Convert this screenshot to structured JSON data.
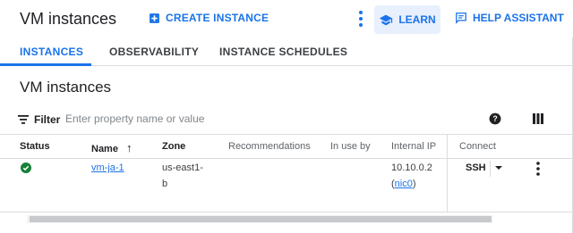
{
  "header": {
    "title": "VM instances",
    "create_label": "CREATE INSTANCE",
    "learn_label": "LEARN",
    "help_label": "HELP ASSISTANT"
  },
  "tabs": [
    {
      "label": "INSTANCES",
      "active": true
    },
    {
      "label": "OBSERVABILITY",
      "active": false
    },
    {
      "label": "INSTANCE SCHEDULES",
      "active": false
    }
  ],
  "section": {
    "title": "VM instances"
  },
  "filter": {
    "label": "Filter",
    "placeholder": "Enter property name or value"
  },
  "table": {
    "columns": [
      "Status",
      "Name",
      "Zone",
      "Recommendations",
      "In use by",
      "Internal IP",
      "Connect"
    ],
    "sort_indicator": "↑",
    "rows": [
      {
        "status": "running",
        "name": "vm-ja-1",
        "zone_line1": "us-east1-",
        "zone_line2": "b",
        "recommendations": "",
        "in_use_by": "",
        "ip_line1": "10.10.0.2",
        "ip_paren_open": "(",
        "ip_nic": "nic0",
        "ip_paren_close": ")",
        "connect_label": "SSH"
      }
    ]
  },
  "icons": {
    "create": "add-box-icon",
    "more_top": "more-vert-icon",
    "learn": "school-icon",
    "help": "chat-icon",
    "filter": "filter-list-icon",
    "help_circle": "help-icon",
    "columns": "view-column-icon",
    "status": "check-circle-icon",
    "ssh_dropdown": "arrow-drop-down-icon",
    "row_more": "more-vert-icon"
  },
  "colors": {
    "accent": "#1a73e8",
    "success": "#188038",
    "learn_bg": "#e8f0fe",
    "border": "#dadce0"
  }
}
